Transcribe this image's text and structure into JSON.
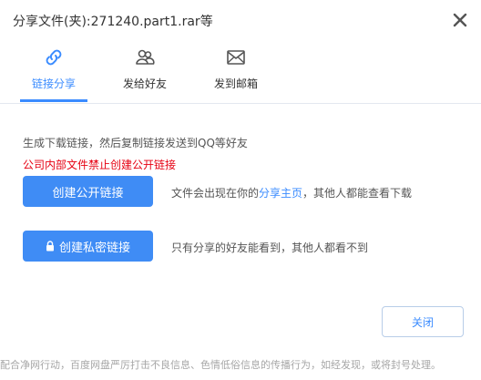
{
  "dialog": {
    "title": "分享文件(夹):271240.part1.rar等",
    "close_icon": "close-icon"
  },
  "tabs": [
    {
      "label": "链接分享",
      "icon": "link-icon",
      "active": true
    },
    {
      "label": "发给好友",
      "icon": "friends-icon",
      "active": false
    },
    {
      "label": "发到邮箱",
      "icon": "mail-icon",
      "active": false
    }
  ],
  "content": {
    "description": "生成下载链接，然后复制链接发送到QQ等好友",
    "warning": "公司内部文件禁止创建公开链接",
    "public_button": "创建公开链接",
    "public_note_before": "文件会出现在你的",
    "public_note_link": "分享主页",
    "public_note_after": "，其他人都能查看下载",
    "private_button": "创建私密链接",
    "private_note": "只有分享的好友能看到，其他人都看不到",
    "close_button": "关闭"
  },
  "footer": {
    "text": "配合净网行动，百度网盘严厉打击不良信息、色情低俗信息的传播行为，如经发现，或将封号处理。"
  },
  "colors": {
    "accent": "#3b8cff",
    "primary_button": "#3f8cf5",
    "warning": "#e60012"
  }
}
